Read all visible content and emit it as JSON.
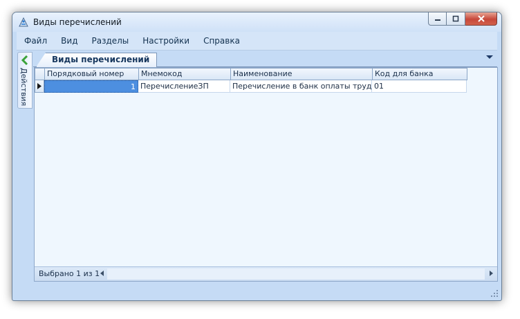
{
  "window": {
    "title": "Виды перечислений"
  },
  "menu": [
    "Файл",
    "Вид",
    "Разделы",
    "Настройки",
    "Справка"
  ],
  "side_panel": {
    "label": "Действия"
  },
  "tab": {
    "label": "Виды перечислений"
  },
  "grid": {
    "columns": [
      "Порядковый номер",
      "Мнемокод",
      "Наименование",
      "Код для банка"
    ],
    "rows": [
      {
        "number": "1",
        "mnemocode": "ПеречислениеЗП",
        "name": "Перечисление в банк оплаты труда",
        "bank_code": "01"
      }
    ]
  },
  "status": {
    "text": "Выбрано 1 из 1"
  },
  "colors": {
    "selection": "#4d8fe0",
    "window_frame": "#c5dbf5",
    "content_bg": "#eff7fe",
    "close_button": "#c7483a"
  }
}
